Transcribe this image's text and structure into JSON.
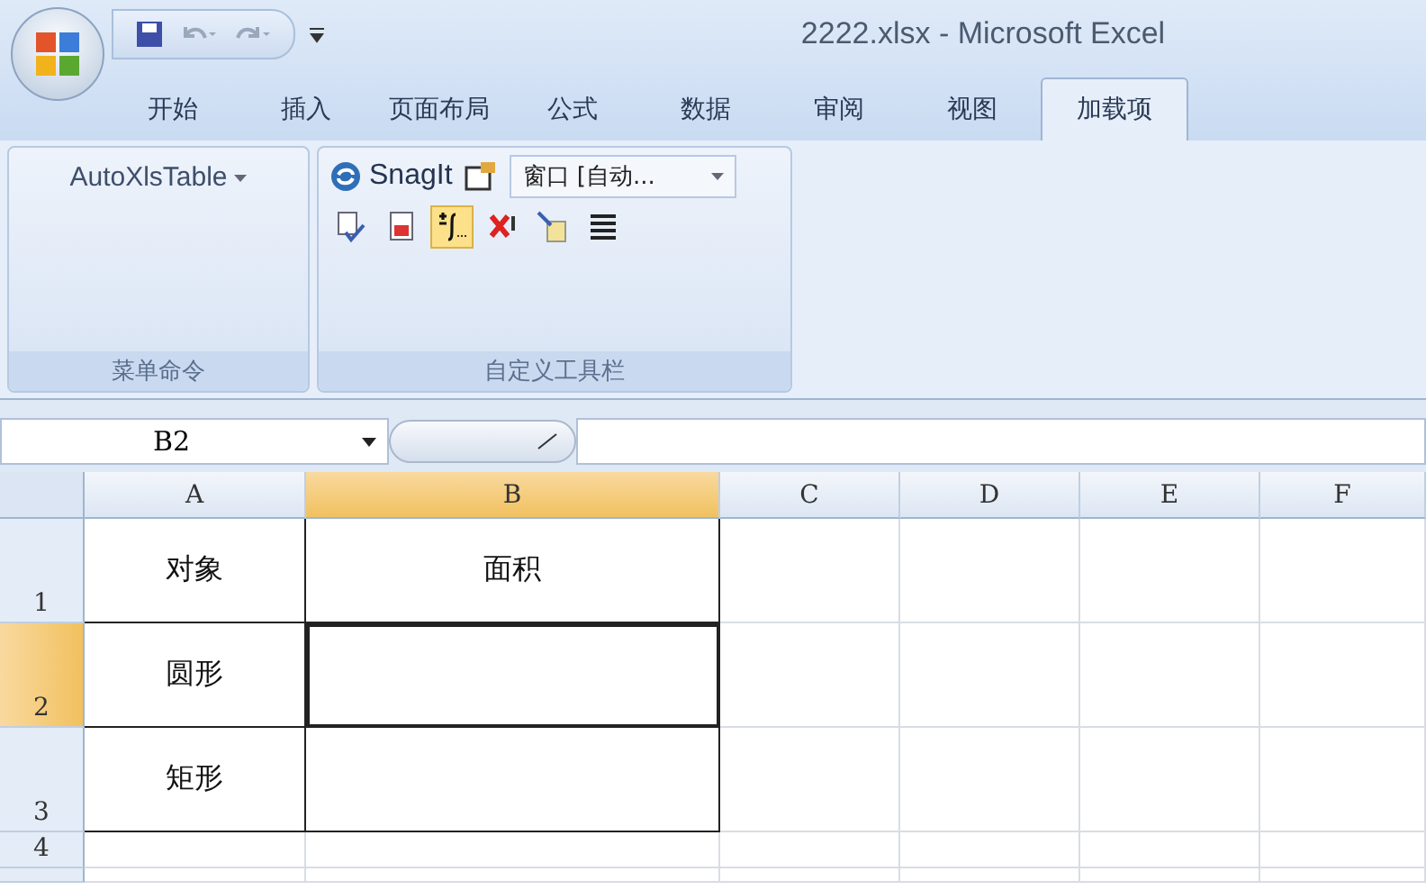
{
  "window": {
    "title": "2222.xlsx - Microsoft Excel"
  },
  "tabs": [
    {
      "label": "开始",
      "selected": false
    },
    {
      "label": "插入",
      "selected": false
    },
    {
      "label": "页面布局",
      "selected": false
    },
    {
      "label": "公式",
      "selected": false
    },
    {
      "label": "数据",
      "selected": false
    },
    {
      "label": "审阅",
      "selected": false
    },
    {
      "label": "视图",
      "selected": false
    },
    {
      "label": "加载项",
      "selected": true
    }
  ],
  "ribbon": {
    "menu_group": {
      "label": "菜单命令",
      "button": "AutoXlsTable"
    },
    "toolbar_group": {
      "label": "自定义工具栏",
      "snagit": "SnagIt",
      "window_dropdown": "窗口 [自动...",
      "tools": [
        {
          "kind": "doc-check",
          "hovered": false
        },
        {
          "kind": "doc-red",
          "hovered": false
        },
        {
          "kind": "formula",
          "hovered": true
        },
        {
          "kind": "cross",
          "hovered": false
        },
        {
          "kind": "wand",
          "hovered": false
        },
        {
          "kind": "list",
          "hovered": false
        }
      ]
    }
  },
  "formula_bar": {
    "name_box": "B2"
  },
  "sheet": {
    "columns": [
      {
        "label": "A",
        "selected": false
      },
      {
        "label": "B",
        "selected": true
      },
      {
        "label": "C",
        "selected": false
      },
      {
        "label": "D",
        "selected": false
      },
      {
        "label": "E",
        "selected": false
      },
      {
        "label": "F",
        "selected": false
      }
    ],
    "rows": [
      {
        "header": "1",
        "selected": false,
        "cells": [
          {
            "text": "对象",
            "selected": false
          },
          {
            "text": "面积",
            "selected": false
          }
        ]
      },
      {
        "header": "2",
        "selected": true,
        "cells": [
          {
            "text": "圆形",
            "selected": false
          },
          {
            "selected": true
          }
        ]
      },
      {
        "header": "3",
        "selected": false,
        "cells": [
          {
            "text": "矩形",
            "selected": false
          },
          {
            "selected": false
          }
        ]
      },
      {
        "header": "4",
        "selected": false,
        "cells": []
      }
    ]
  }
}
